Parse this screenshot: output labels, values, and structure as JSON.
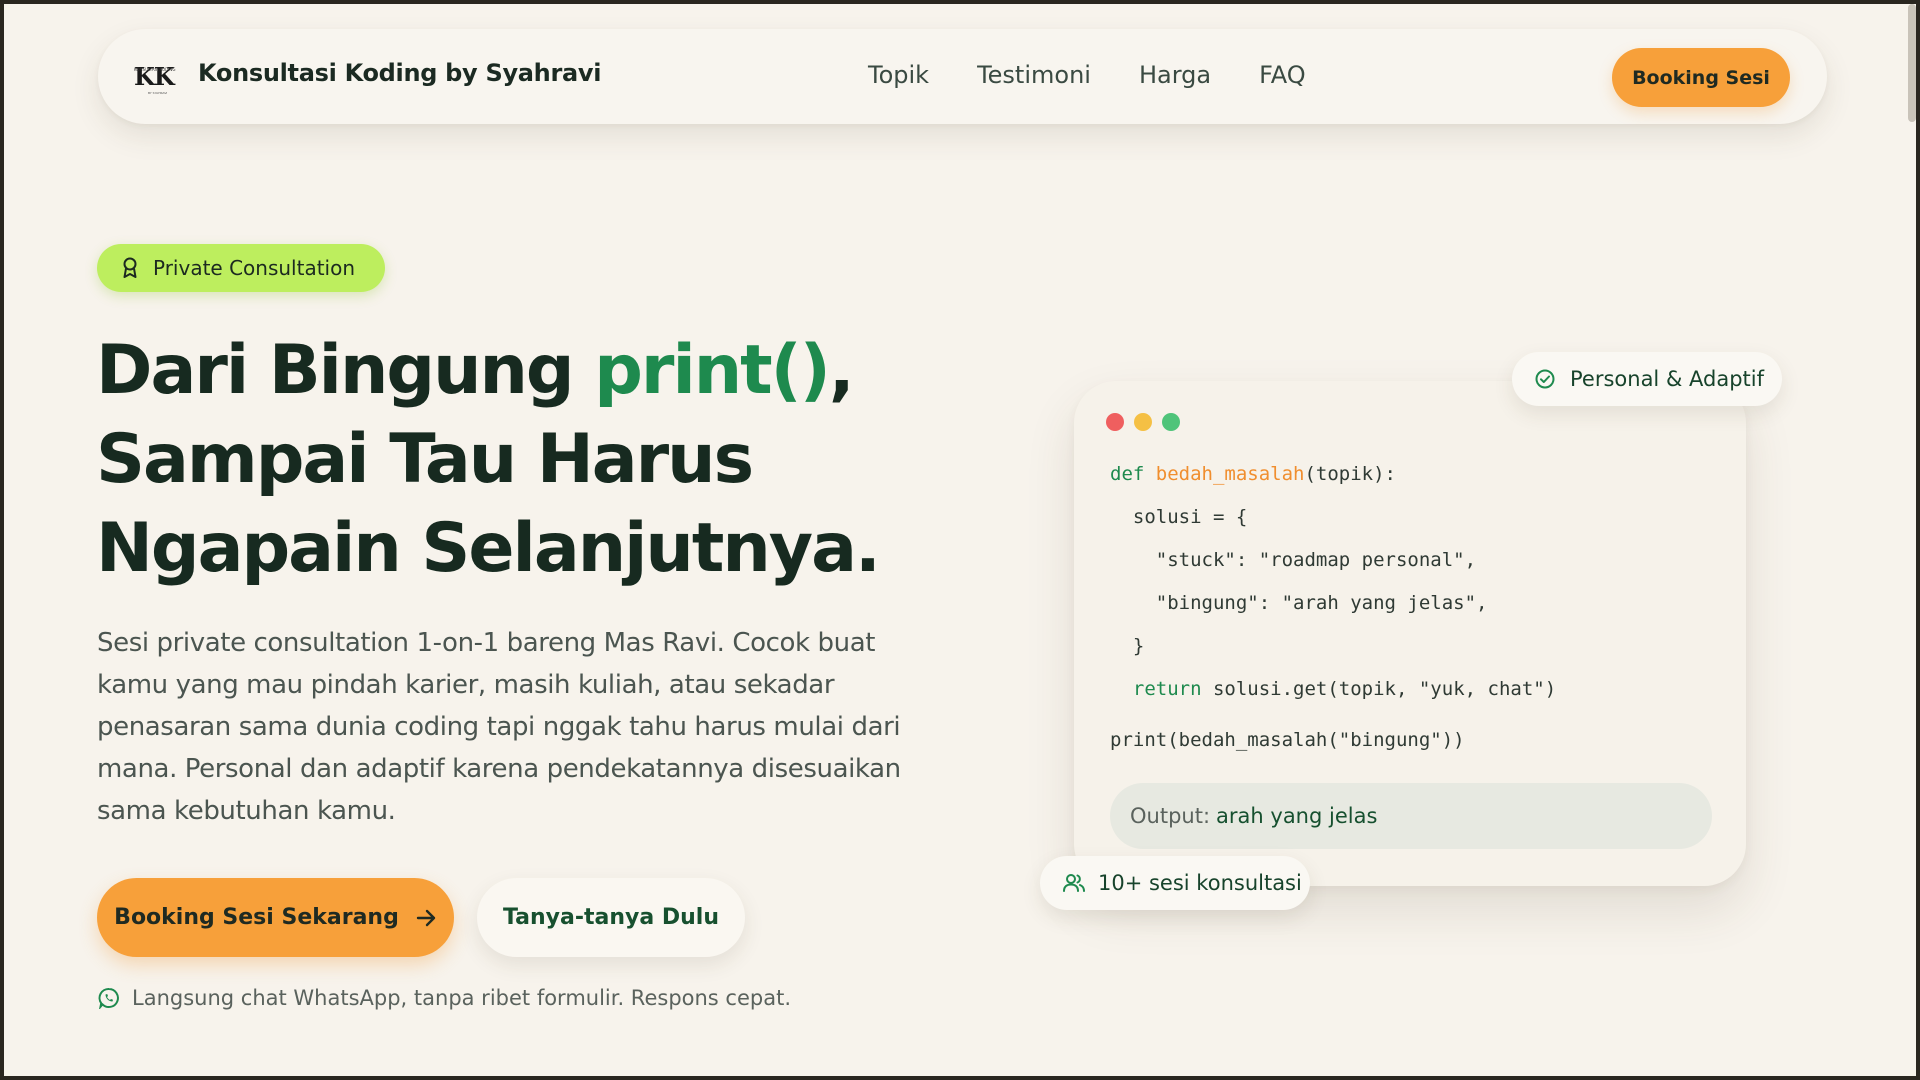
{
  "nav": {
    "logo_text": "KK",
    "logo_top": "KONSULTASI KODING",
    "logo_bottom": "BY SYAHRAVI",
    "brand": "Konsultasi Koding by Syahravi",
    "links": [
      "Topik",
      "Testimoni",
      "Harga",
      "FAQ"
    ],
    "cta": "Booking Sesi"
  },
  "hero": {
    "badge": "Private Consultation",
    "headline_1_prefix": "Dari Bingung ",
    "headline_1_accent": "print()",
    "headline_1_suffix": ",",
    "headline_2": "Sampai Tau Harus",
    "headline_3": "Ngapain Selanjutnya.",
    "lead": "Sesi private consultation 1-on-1 bareng Mas Ravi. Cocok buat kamu yang mau pindah karier, masih kuliah, atau sekadar penasaran sama dunia coding tapi nggak tahu harus mulai dari mana. Personal dan adaptif karena pendekatannya disesuaikan sama kebutuhan kamu.",
    "primary_cta": "Booking Sesi Sekarang",
    "secondary_cta": "Tanya-tanya Dulu",
    "note": "Langsung chat WhatsApp, tanpa ribet formulir. Respons cepat."
  },
  "code_card": {
    "window_dots": [
      "#ef5f5f",
      "#f5c044",
      "#4fc47a"
    ],
    "lines": {
      "l1_kw": "def ",
      "l1_fn": "bedah_masalah",
      "l1_rest": "(topik):",
      "l2": "  solusi = {",
      "l3": "    \"stuck\": \"roadmap personal\",",
      "l4": "    \"bingung\": \"arah yang jelas\",",
      "l5": "  }",
      "l6_indent": "  ",
      "l6_kw": "return",
      "l6_rest": " solusi.get(topik, \"yuk, chat\")",
      "l7": "print(bedah_masalah(\"bingung\"))"
    },
    "output_label": "Output:",
    "output_value": "arah yang jelas",
    "tag_top": "Personal & Adaptif",
    "tag_bottom": "10+ sesi konsultasi"
  },
  "colors": {
    "accent_orange": "#f7a03a",
    "accent_green": "#1e8a4e",
    "badge_lime": "#bdee5e",
    "background": "#f7f3ec"
  }
}
